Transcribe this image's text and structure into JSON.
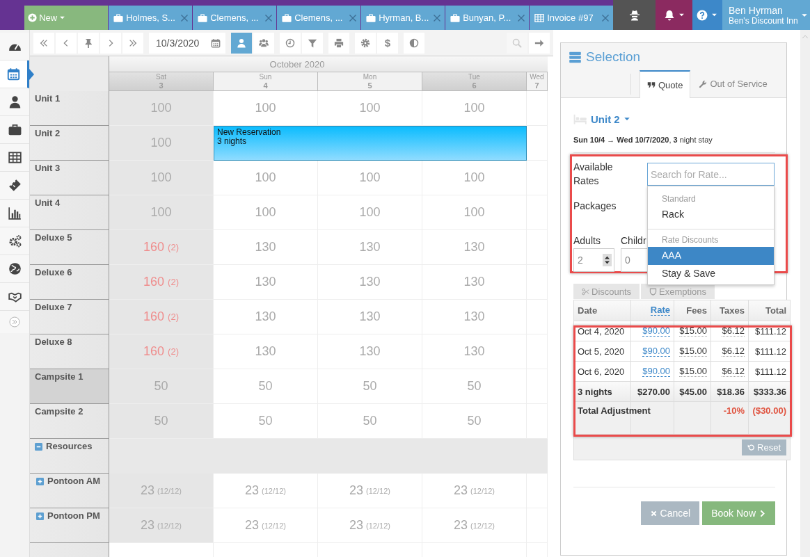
{
  "topbar": {
    "tabs": [
      {
        "kind": "new",
        "label": "New"
      },
      {
        "kind": "case",
        "label": "Holmes, S..."
      },
      {
        "kind": "case",
        "label": "Clemens, ..."
      },
      {
        "kind": "case",
        "label": "Clemens, ..."
      },
      {
        "kind": "case",
        "label": "Hyrman, B..."
      },
      {
        "kind": "case",
        "label": "Bunyan, P..."
      },
      {
        "kind": "invoice",
        "label": "Invoice #97"
      }
    ],
    "buttons": [
      {
        "kind": "incognito"
      },
      {
        "kind": "alerts"
      },
      {
        "kind": "help"
      }
    ],
    "user": {
      "name": "Ben Hyrman",
      "property": "Ben's Discount Inn"
    }
  },
  "sidebar": {
    "items": [
      {
        "kind": "dashboard",
        "selected": false
      },
      {
        "kind": "calendar",
        "selected": true
      },
      {
        "kind": "person",
        "selected": false
      },
      {
        "kind": "briefcase",
        "selected": false
      },
      {
        "kind": "table",
        "selected": false
      },
      {
        "kind": "ticket",
        "selected": false
      },
      {
        "kind": "chart",
        "selected": false
      },
      {
        "kind": "gears",
        "selected": false
      },
      {
        "kind": "globe",
        "selected": false
      },
      {
        "kind": "handshake",
        "selected": false
      },
      {
        "kind": "expand",
        "selected": false
      }
    ]
  },
  "toolbar": {
    "groups": [
      [
        {
          "kind": "first"
        },
        {
          "kind": "prev"
        },
        {
          "kind": "pin"
        },
        {
          "kind": "next"
        },
        {
          "kind": "last"
        }
      ],
      [
        {
          "kind": "date",
          "value": "10/3/2020"
        }
      ],
      [
        {
          "kind": "person",
          "selected": true
        },
        {
          "kind": "group",
          "selected": false
        }
      ],
      [
        {
          "kind": "clock"
        },
        {
          "kind": "filter"
        }
      ],
      [
        {
          "kind": "print"
        }
      ],
      [
        {
          "kind": "settings"
        },
        {
          "kind": "dollar",
          "label": "$"
        }
      ],
      [
        {
          "kind": "contrast"
        }
      ],
      [
        {
          "kind": "search",
          "disabled": true
        },
        {
          "kind": "go",
          "disabled": false
        }
      ]
    ]
  },
  "calendar": {
    "month": "October 2020",
    "days": [
      {
        "weekday": "Sat",
        "day": "3",
        "highlighted": true,
        "past": true
      },
      {
        "weekday": "Sun",
        "day": "4",
        "highlighted": false,
        "past": false
      },
      {
        "weekday": "Mon",
        "day": "5",
        "highlighted": false,
        "past": false
      },
      {
        "weekday": "Tue",
        "day": "6",
        "highlighted": true,
        "past": false
      },
      {
        "weekday": "Wed",
        "day": "7",
        "highlighted": false,
        "past": false
      }
    ],
    "rows": [
      {
        "label": "Unit 1",
        "kind": "unit",
        "selected": false,
        "cells": [
          {
            "kind": "rate",
            "rate": "100",
            "alert": false
          },
          {
            "kind": "rate",
            "rate": "100",
            "alert": false
          },
          {
            "kind": "rate",
            "rate": "100",
            "alert": false
          },
          {
            "kind": "rate",
            "rate": "100",
            "alert": false
          }
        ]
      },
      {
        "label": "Unit 2",
        "kind": "unit",
        "selected": false,
        "cells": [
          {
            "kind": "rate",
            "rate": "100",
            "alert": false
          },
          {
            "kind": "reservation",
            "title": "New Reservation",
            "detail": "3 nights"
          },
          {
            "kind": "covered"
          },
          {
            "kind": "covered"
          }
        ]
      },
      {
        "label": "Unit 3",
        "kind": "unit",
        "selected": false,
        "cells": [
          {
            "kind": "rate",
            "rate": "100",
            "alert": false
          },
          {
            "kind": "rate",
            "rate": "100",
            "alert": false
          },
          {
            "kind": "rate",
            "rate": "100",
            "alert": false
          },
          {
            "kind": "rate",
            "rate": "100",
            "alert": false
          }
        ]
      },
      {
        "label": "Unit 4",
        "kind": "unit",
        "selected": false,
        "cells": [
          {
            "kind": "rate",
            "rate": "100",
            "alert": false
          },
          {
            "kind": "rate",
            "rate": "100",
            "alert": false
          },
          {
            "kind": "rate",
            "rate": "100",
            "alert": false
          },
          {
            "kind": "rate",
            "rate": "100",
            "alert": false
          }
        ]
      },
      {
        "label": "Deluxe 5",
        "kind": "unit",
        "selected": false,
        "cells": [
          {
            "kind": "rate",
            "rate": "160",
            "count": "(2)",
            "alert": true
          },
          {
            "kind": "rate",
            "rate": "130",
            "alert": false
          },
          {
            "kind": "rate",
            "rate": "130",
            "alert": false
          },
          {
            "kind": "rate",
            "rate": "130",
            "alert": false
          }
        ]
      },
      {
        "label": "Deluxe 6",
        "kind": "unit",
        "selected": false,
        "cells": [
          {
            "kind": "rate",
            "rate": "160",
            "count": "(2)",
            "alert": true
          },
          {
            "kind": "rate",
            "rate": "130",
            "alert": false
          },
          {
            "kind": "rate",
            "rate": "130",
            "alert": false
          },
          {
            "kind": "rate",
            "rate": "130",
            "alert": false
          }
        ]
      },
      {
        "label": "Deluxe 7",
        "kind": "unit",
        "selected": false,
        "cells": [
          {
            "kind": "rate",
            "rate": "160",
            "count": "(2)",
            "alert": true
          },
          {
            "kind": "rate",
            "rate": "130",
            "alert": false
          },
          {
            "kind": "rate",
            "rate": "130",
            "alert": false
          },
          {
            "kind": "rate",
            "rate": "130",
            "alert": false
          }
        ]
      },
      {
        "label": "Deluxe 8",
        "kind": "unit",
        "selected": false,
        "cells": [
          {
            "kind": "rate",
            "rate": "160",
            "count": "(2)",
            "alert": true
          },
          {
            "kind": "rate",
            "rate": "130",
            "alert": false
          },
          {
            "kind": "rate",
            "rate": "130",
            "alert": false
          },
          {
            "kind": "rate",
            "rate": "130",
            "alert": false
          }
        ]
      },
      {
        "label": "Campsite 1",
        "kind": "unit",
        "selected": true,
        "cells": [
          {
            "kind": "rate",
            "rate": "50",
            "alert": false
          },
          {
            "kind": "rate",
            "rate": "50",
            "alert": false
          },
          {
            "kind": "rate",
            "rate": "50",
            "alert": false
          },
          {
            "kind": "rate",
            "rate": "50",
            "alert": false
          }
        ]
      },
      {
        "label": "Campsite 2",
        "kind": "unit",
        "selected": false,
        "cells": [
          {
            "kind": "rate",
            "rate": "50",
            "alert": false
          },
          {
            "kind": "rate",
            "rate": "50",
            "alert": false
          },
          {
            "kind": "rate",
            "rate": "50",
            "alert": false
          },
          {
            "kind": "rate",
            "rate": "50",
            "alert": false
          }
        ]
      },
      {
        "label": "Resources",
        "kind": "group",
        "selected": false,
        "expanded": true,
        "children": [
          {
            "label": "Pontoon AM",
            "kind": "group",
            "selected": false,
            "expanded": false,
            "cells": [
              {
                "kind": "rate",
                "rate": "23",
                "count": "(12/12)",
                "alert": false
              },
              {
                "kind": "rate",
                "rate": "23",
                "count": "(12/12)",
                "alert": false
              },
              {
                "kind": "rate",
                "rate": "23",
                "count": "(12/12)",
                "alert": false
              },
              {
                "kind": "rate",
                "rate": "23",
                "count": "(12/12)",
                "alert": false
              }
            ]
          },
          {
            "label": "Pontoon PM",
            "kind": "group",
            "selected": false,
            "expanded": false,
            "cells": [
              {
                "kind": "rate",
                "rate": "23",
                "count": "(12/12)",
                "alert": false
              },
              {
                "kind": "rate",
                "rate": "23",
                "count": "(12/12)",
                "alert": false
              },
              {
                "kind": "rate",
                "rate": "23",
                "count": "(12/12)",
                "alert": false
              },
              {
                "kind": "rate",
                "rate": "23",
                "count": "(12/12)",
                "alert": false
              }
            ]
          }
        ]
      }
    ]
  },
  "panel": {
    "title": "Selection",
    "tabs": [
      {
        "kind": "quote",
        "label": "Quote",
        "selected": true
      },
      {
        "kind": "service",
        "label": "Out of Service",
        "selected": false
      }
    ],
    "unit": "Unit 2",
    "stay": "**Sun 10/4 → Wed 10/7/2020**, **3** night stay",
    "form": {
      "highlighted": true,
      "rates_label": "Available Rates",
      "rate_search": {
        "placeholder": "Search for Rate..."
      },
      "rate_menu": [
        {
          "header": "Standard",
          "options": [
            {
              "label": "Rack",
              "selected": false
            }
          ]
        },
        {
          "header": "Rate Discounts",
          "options": [
            {
              "label": "AAA",
              "selected": true
            },
            {
              "label": "Stay & Save",
              "selected": false
            }
          ]
        }
      ],
      "packages_label": "Packages",
      "adults": {
        "label": "Adults",
        "value": "2"
      },
      "children": {
        "label": "Childr",
        "value": "0"
      },
      "subtabs": [
        {
          "kind": "discounts",
          "label": "Discounts"
        },
        {
          "kind": "exemptions",
          "label": "Exemptions"
        }
      ]
    },
    "quote_table": {
      "highlighted": true,
      "columns": [
        {
          "label": "Date",
          "kind": "plain"
        },
        {
          "label": "Rate",
          "kind": "link"
        },
        {
          "label": "Fees",
          "kind": "detail"
        },
        {
          "label": "Taxes",
          "kind": "detail"
        },
        {
          "label": "Total",
          "kind": "plain"
        }
      ],
      "rows": [
        [
          "Oct 4, 2020",
          "$90.00",
          "$15.00",
          "$6.12",
          "$111.12"
        ],
        [
          "Oct 5, 2020",
          "$90.00",
          "$15.00",
          "$6.12",
          "$111.12"
        ],
        [
          "Oct 6, 2020",
          "$90.00",
          "$15.00",
          "$6.12",
          "$111.12"
        ]
      ],
      "total": [
        "3 nights",
        "$270.00",
        "$45.00",
        "$18.36",
        "$333.36"
      ],
      "adjustment": {
        "label": "Total Adjustment",
        "percent": "-10%",
        "amount": "($30.00)"
      },
      "reset": "Reset"
    },
    "actions": [
      {
        "kind": "cancel",
        "label": "Cancel"
      },
      {
        "kind": "book",
        "label": "Book Now"
      }
    ]
  }
}
